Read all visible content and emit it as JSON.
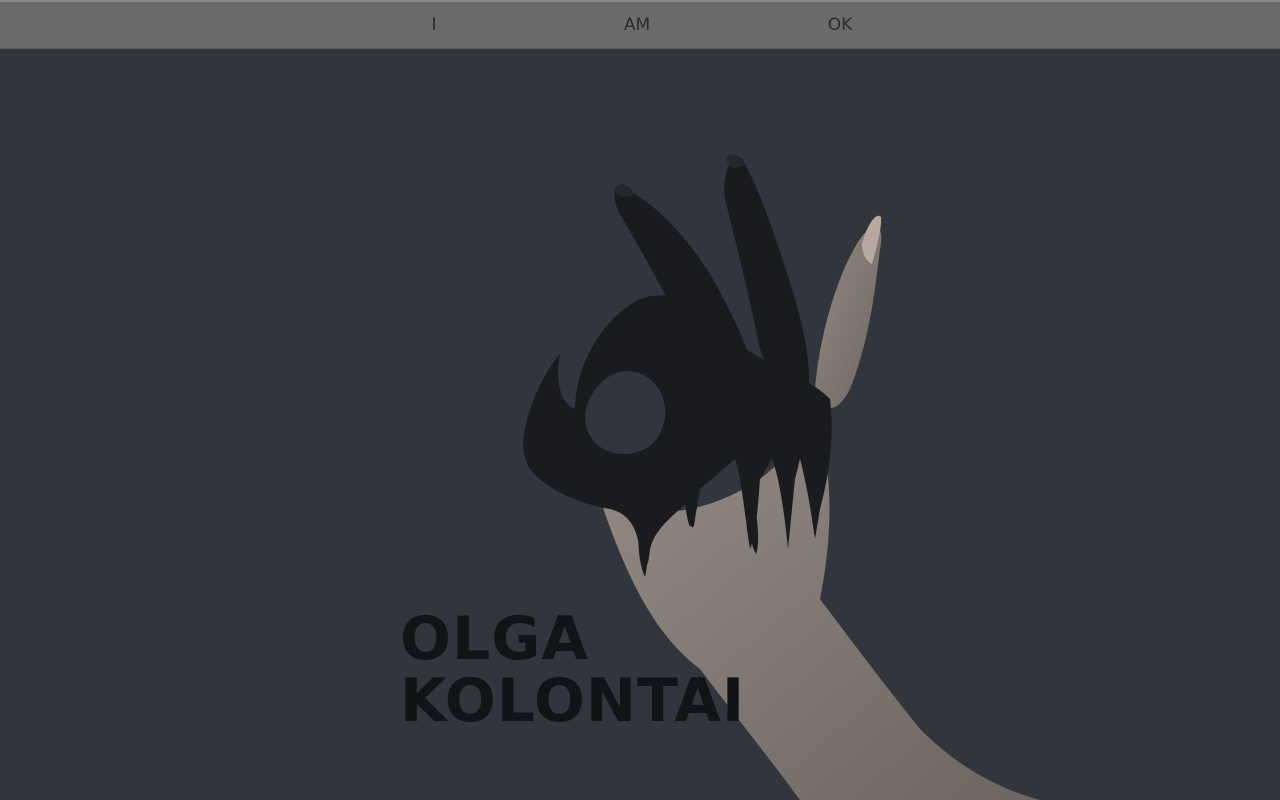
{
  "nav": {
    "items": [
      {
        "label": "I"
      },
      {
        "label": "AM"
      },
      {
        "label": "OK"
      }
    ]
  },
  "hero": {
    "image_icon": "ok-hand-gesture-painted-black",
    "name_line1": "OLGA",
    "name_line2": "KOLONTAI"
  },
  "colors": {
    "background": "#31353d",
    "nav_background": "#6b6b6b",
    "nav_text": "#2b2b2b",
    "paint": "#1a1b1e",
    "skin": "#8a7f7a",
    "title": "#111317"
  }
}
